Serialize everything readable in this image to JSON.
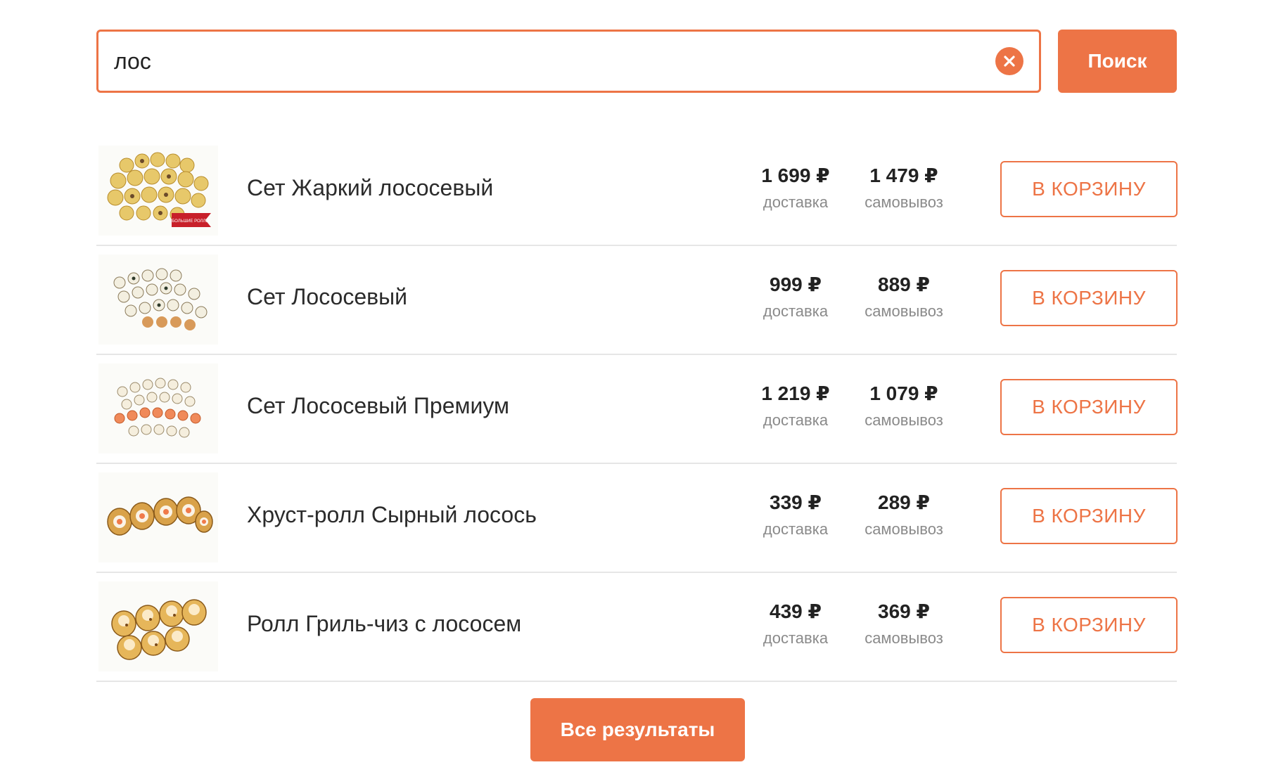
{
  "search": {
    "value": "лос",
    "clear_icon": "close-circle-icon",
    "button_label": "Поиск"
  },
  "accent_color": "#ed7446",
  "results": [
    {
      "name": "Сет Жаркий лососевый",
      "delivery_price": "1 699 ₽",
      "delivery_label": "доставка",
      "pickup_price": "1 479 ₽",
      "pickup_label": "самовывоз",
      "cart_label": "В КОРЗИНУ",
      "badge_text": "БОЛЬШИЕ РОЛЛЫ"
    },
    {
      "name": "Сет Лососевый",
      "delivery_price": "999 ₽",
      "delivery_label": "доставка",
      "pickup_price": "889 ₽",
      "pickup_label": "самовывоз",
      "cart_label": "В КОРЗИНУ"
    },
    {
      "name": "Сет Лососевый Премиум",
      "delivery_price": "1 219 ₽",
      "delivery_label": "доставка",
      "pickup_price": "1 079 ₽",
      "pickup_label": "самовывоз",
      "cart_label": "В КОРЗИНУ"
    },
    {
      "name": "Хруст-ролл Сырный лосось",
      "delivery_price": "339 ₽",
      "delivery_label": "доставка",
      "pickup_price": "289 ₽",
      "pickup_label": "самовывоз",
      "cart_label": "В КОРЗИНУ"
    },
    {
      "name": "Ролл Гриль-чиз с лососем",
      "delivery_price": "439 ₽",
      "delivery_label": "доставка",
      "pickup_price": "369 ₽",
      "pickup_label": "самовывоз",
      "cart_label": "В КОРЗИНУ"
    }
  ],
  "all_results_label": "Все результаты"
}
